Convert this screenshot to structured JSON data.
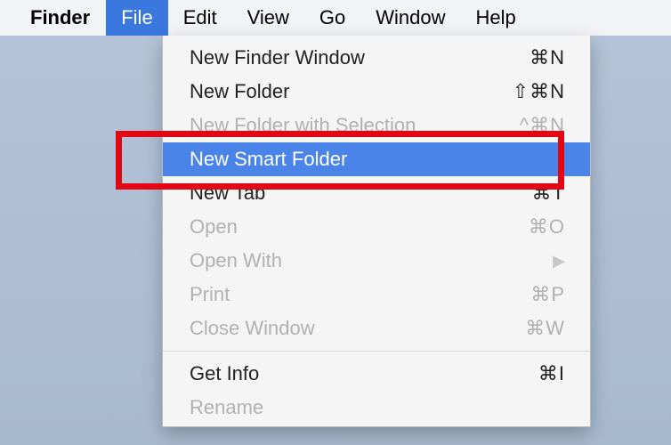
{
  "menubar": {
    "app_name": "Finder",
    "items": [
      {
        "label": "File",
        "active": true
      },
      {
        "label": "Edit"
      },
      {
        "label": "View"
      },
      {
        "label": "Go"
      },
      {
        "label": "Window"
      },
      {
        "label": "Help"
      }
    ]
  },
  "dropdown": {
    "items": [
      {
        "label": "New Finder Window",
        "shortcut": "⌘N",
        "enabled": true
      },
      {
        "label": "New Folder",
        "shortcut": "⇧⌘N",
        "enabled": true
      },
      {
        "label": "New Folder with Selection",
        "shortcut": "^⌘N",
        "enabled": false
      },
      {
        "label": "New Smart Folder",
        "shortcut": "",
        "enabled": true,
        "highlighted": true
      },
      {
        "label": "New Tab",
        "shortcut": "⌘T",
        "enabled": true
      },
      {
        "label": "Open",
        "shortcut": "⌘O",
        "enabled": false
      },
      {
        "label": "Open With",
        "shortcut": "",
        "enabled": false,
        "submenu": true
      },
      {
        "label": "Print",
        "shortcut": "⌘P",
        "enabled": false
      },
      {
        "label": "Close Window",
        "shortcut": "⌘W",
        "enabled": false
      },
      {
        "separator": true
      },
      {
        "label": "Get Info",
        "shortcut": "⌘I",
        "enabled": true
      },
      {
        "label": "Rename",
        "shortcut": "",
        "enabled": false
      }
    ]
  }
}
